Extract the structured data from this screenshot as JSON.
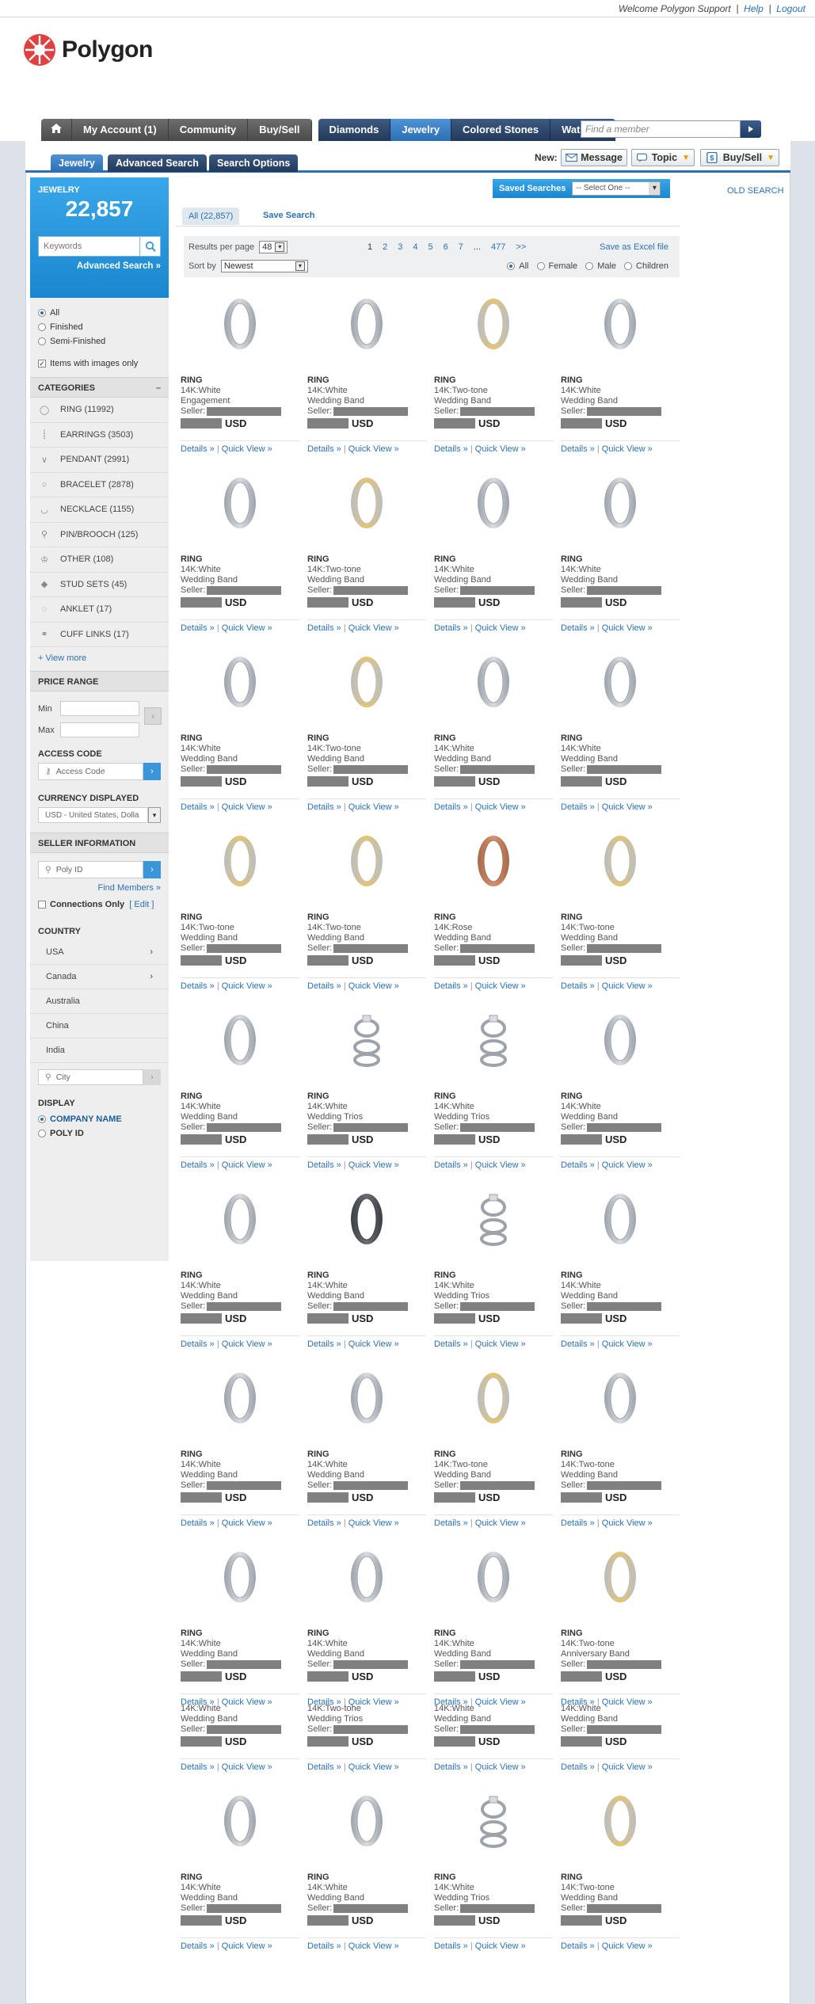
{
  "header": {
    "welcome_text": "Welcome Polygon Support",
    "help_label": "Help",
    "logout_label": "Logout",
    "logo_text": "Polygon"
  },
  "nav": {
    "my_account": "My Account (1)",
    "community": "Community",
    "buy_sell": "Buy/Sell",
    "diamonds": "Diamonds",
    "jewelry": "Jewelry",
    "colored_stones": "Colored Stones",
    "watches": "Watches",
    "member_placeholder": "Find a member"
  },
  "subtabs": {
    "jewelry": "Jewelry",
    "advanced": "Advanced Search",
    "options": "Search Options"
  },
  "new_bar": {
    "label": "New:",
    "message": "Message",
    "topic": "Topic",
    "buy_sell": "Buy/Sell"
  },
  "sidebar": {
    "title": "JEWELRY",
    "count": "22,857",
    "keywords_placeholder": "Keywords",
    "advanced_link": "Advanced Search »",
    "finish": [
      "All",
      "Finished",
      "Semi-Finished"
    ],
    "images_only": "Items with images only",
    "categories_title": "CATEGORIES",
    "categories": [
      "RING (11992)",
      "EARRINGS (3503)",
      "PENDANT (2991)",
      "BRACELET (2878)",
      "NECKLACE (1155)",
      "PIN/BROOCH (125)",
      "OTHER (108)",
      "STUD SETS (45)",
      "ANKLET (17)",
      "CUFF LINKS (17)"
    ],
    "view_more": "+ View more",
    "price_title": "PRICE RANGE",
    "min_label": "Min",
    "max_label": "Max",
    "access_title": "ACCESS CODE",
    "access_placeholder": "Access Code",
    "currency_title": "CURRENCY DISPLAYED",
    "currency_value": "USD - United States, Dolla",
    "seller_title": "SELLER INFORMATION",
    "poly_placeholder": "Poly ID",
    "find_members": "Find Members »",
    "connections_only": "Connections Only",
    "edit_label": "[ Edit ]",
    "country_title": "COUNTRY",
    "countries": [
      "USA",
      "Canada",
      "Australia",
      "China",
      "India"
    ],
    "city_placeholder": "City",
    "display_title": "DISPLAY",
    "display_options": [
      "COMPANY NAME",
      "POLY ID"
    ]
  },
  "results": {
    "saved_searches": "Saved Searches",
    "saved_select": "-- Select One --",
    "old_search": "OLD SEARCH",
    "all_tab": "All (22,857)",
    "save_search": "Save Search",
    "per_page_label": "Results per page",
    "per_page_value": "48",
    "sort_label": "Sort by",
    "sort_value": "Newest",
    "pages": [
      "1",
      "2",
      "3",
      "4",
      "5",
      "6",
      "7",
      "...",
      "477",
      ">>"
    ],
    "excel_link": "Save as Excel file",
    "filters": [
      "All",
      "Female",
      "Male",
      "Children"
    ]
  },
  "card_labels": {
    "seller": "Seller:",
    "currency": "USD",
    "details": "Details »",
    "quick_view": "Quick View »"
  },
  "items": [
    {
      "type": "RING",
      "metal": "14K:White",
      "style": "Engagement",
      "tone": "white"
    },
    {
      "type": "RING",
      "metal": "14K:White",
      "style": "Wedding Band",
      "tone": "white"
    },
    {
      "type": "RING",
      "metal": "14K:Two-tone",
      "style": "Wedding Band",
      "tone": "two"
    },
    {
      "type": "RING",
      "metal": "14K:White",
      "style": "Wedding Band",
      "tone": "white"
    },
    {
      "type": "RING",
      "metal": "14K:White",
      "style": "Wedding Band",
      "tone": "white"
    },
    {
      "type": "RING",
      "metal": "14K:Two-tone",
      "style": "Wedding Band",
      "tone": "two"
    },
    {
      "type": "RING",
      "metal": "14K:White",
      "style": "Wedding Band",
      "tone": "white"
    },
    {
      "type": "RING",
      "metal": "14K:White",
      "style": "Wedding Band",
      "tone": "white"
    },
    {
      "type": "RING",
      "metal": "14K:White",
      "style": "Wedding Band",
      "tone": "white"
    },
    {
      "type": "RING",
      "metal": "14K:Two-tone",
      "style": "Wedding Band",
      "tone": "two"
    },
    {
      "type": "RING",
      "metal": "14K:White",
      "style": "Wedding Band",
      "tone": "white"
    },
    {
      "type": "RING",
      "metal": "14K:White",
      "style": "Wedding Band",
      "tone": "white"
    },
    {
      "type": "RING",
      "metal": "14K:Two-tone",
      "style": "Wedding Band",
      "tone": "two"
    },
    {
      "type": "RING",
      "metal": "14K:Two-tone",
      "style": "Wedding Band",
      "tone": "two"
    },
    {
      "type": "RING",
      "metal": "14K:Rose",
      "style": "Wedding Band",
      "tone": "rose"
    },
    {
      "type": "RING",
      "metal": "14K:Two-tone",
      "style": "Wedding Band",
      "tone": "two"
    },
    {
      "type": "RING",
      "metal": "14K:White",
      "style": "Wedding Band",
      "tone": "white"
    },
    {
      "type": "RING",
      "metal": "14K:White",
      "style": "Wedding Trios",
      "tone": "trio"
    },
    {
      "type": "RING",
      "metal": "14K:White",
      "style": "Wedding Trios",
      "tone": "trio"
    },
    {
      "type": "RING",
      "metal": "14K:White",
      "style": "Wedding Band",
      "tone": "white"
    },
    {
      "type": "RING",
      "metal": "14K:White",
      "style": "Wedding Band",
      "tone": "white"
    },
    {
      "type": "RING",
      "metal": "14K:White",
      "style": "Wedding Band",
      "tone": "dark"
    },
    {
      "type": "RING",
      "metal": "14K:White",
      "style": "Wedding Trios",
      "tone": "trio"
    },
    {
      "type": "RING",
      "metal": "14K:White",
      "style": "Wedding Band",
      "tone": "white"
    },
    {
      "type": "RING",
      "metal": "14K:White",
      "style": "Wedding Band",
      "tone": "white"
    },
    {
      "type": "RING",
      "metal": "14K:White",
      "style": "Wedding Band",
      "tone": "white"
    },
    {
      "type": "RING",
      "metal": "14K:Two-tone",
      "style": "Wedding Band",
      "tone": "two"
    },
    {
      "type": "RING",
      "metal": "14K:Two-tone",
      "style": "Wedding Band",
      "tone": "white"
    },
    {
      "type": "RING",
      "metal": "14K:White",
      "style": "Wedding Band",
      "tone": "white"
    },
    {
      "type": "RING",
      "metal": "14K:White",
      "style": "Wedding Band",
      "tone": "white"
    },
    {
      "type": "RING",
      "metal": "14K:White",
      "style": "Wedding Band",
      "tone": "white"
    },
    {
      "type": "RING",
      "metal": "14K:Two-tone",
      "style": "Anniversary Band",
      "tone": "two"
    },
    {
      "type": "",
      "metal": "14K:White",
      "style": "Wedding Band",
      "tone": "none"
    },
    {
      "type": "",
      "metal": "14K:Two-tone",
      "style": "Wedding Trios",
      "tone": "none"
    },
    {
      "type": "",
      "metal": "14K:White",
      "style": "Wedding Band",
      "tone": "none"
    },
    {
      "type": "",
      "metal": "14K:White",
      "style": "Wedding Band",
      "tone": "none"
    },
    {
      "type": "RING",
      "metal": "14K:White",
      "style": "Wedding Band",
      "tone": "white"
    },
    {
      "type": "RING",
      "metal": "14K:White",
      "style": "Wedding Band",
      "tone": "white"
    },
    {
      "type": "RING",
      "metal": "14K:White",
      "style": "Wedding Trios",
      "tone": "trio"
    },
    {
      "type": "RING",
      "metal": "14K:Two-tone",
      "style": "Wedding Band",
      "tone": "two"
    }
  ],
  "colors": {
    "accent_blue": "#1a86cf",
    "nav_dark": "#22395a",
    "link": "#2a72b5",
    "redaction": "#808080"
  }
}
